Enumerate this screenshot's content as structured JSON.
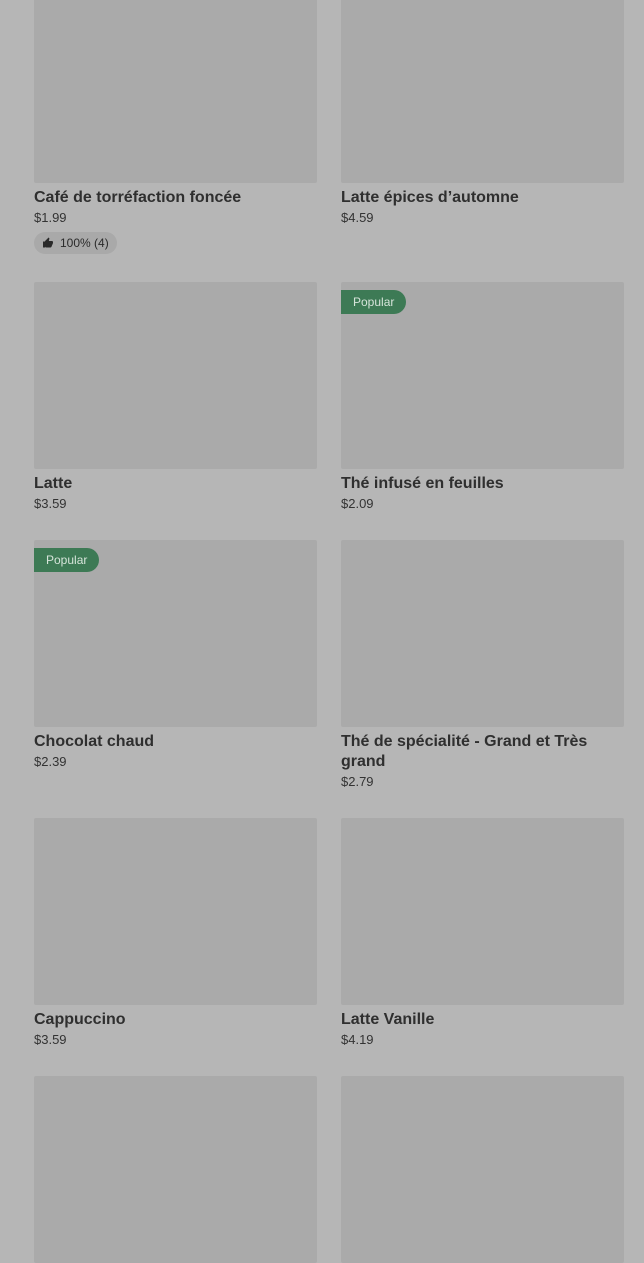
{
  "products": [
    {
      "name": "Café de torréfaction foncée",
      "price": "$1.99",
      "rating": "100% (4)",
      "badge": ""
    },
    {
      "name": "Latte épices d’automne",
      "price": "$4.59",
      "badge": ""
    },
    {
      "name": "Latte",
      "price": "$3.59",
      "badge": ""
    },
    {
      "name": "Thé infusé en feuilles",
      "price": "$2.09",
      "badge": "Popular"
    },
    {
      "name": "Chocolat chaud",
      "price": "$2.39",
      "badge": "Popular"
    },
    {
      "name": "Thé de spécialité - Grand et Très grand",
      "price": "$2.79",
      "badge": ""
    },
    {
      "name": "Cappuccino",
      "price": "$3.59",
      "badge": ""
    },
    {
      "name": "Latte Vanille",
      "price": "$4.19",
      "badge": ""
    }
  ],
  "icons": {
    "rating": "thumbs-up-icon"
  }
}
